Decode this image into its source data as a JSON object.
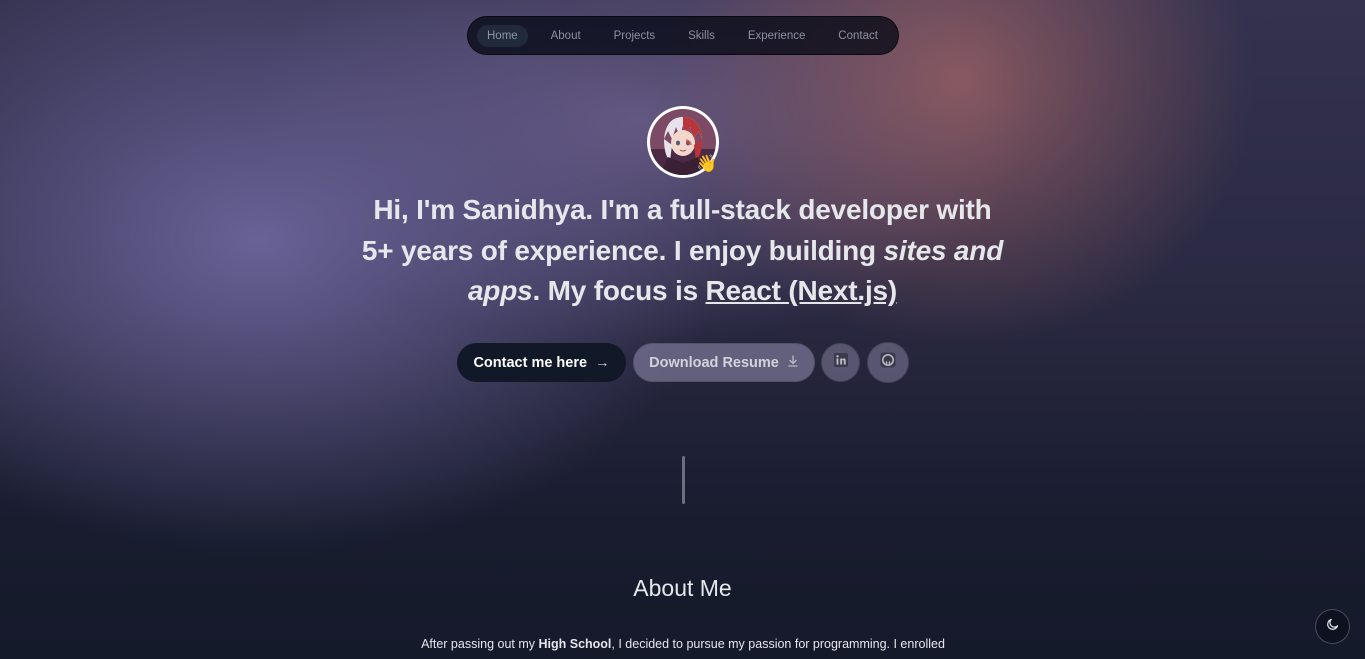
{
  "nav": {
    "items": [
      {
        "label": "Home",
        "active": true
      },
      {
        "label": "About"
      },
      {
        "label": "Projects"
      },
      {
        "label": "Skills"
      },
      {
        "label": "Experience"
      },
      {
        "label": "Contact"
      }
    ]
  },
  "hero": {
    "wave_emoji": "👋",
    "headline": {
      "p1": "Hi, I'm Sanidhya.",
      "p2": " I'm a ",
      "p3": "full-stack developer",
      "p4": " with ",
      "p5": "5+ years",
      "p6": " of experience. I enjoy building ",
      "p7": "sites and apps",
      "p8": ". My focus is ",
      "p9": "React (Next.js)"
    },
    "contact_button": "Contact me here",
    "contact_arrow": "→",
    "resume_button": "Download Resume",
    "resume_icon": "download-icon",
    "social": [
      "linkedin-icon",
      "github-icon"
    ]
  },
  "about": {
    "title": "About Me",
    "text_p1": "After passing out my ",
    "text_p2": "High School",
    "text_p3": ", I decided to pursue my passion for programming. I enrolled"
  },
  "theme_toggle": {
    "icon": "moon-icon"
  },
  "colors": {
    "nav_bg": "#0b0f1c",
    "contact_btn": "#111827",
    "resume_btn": "#7a7695"
  }
}
